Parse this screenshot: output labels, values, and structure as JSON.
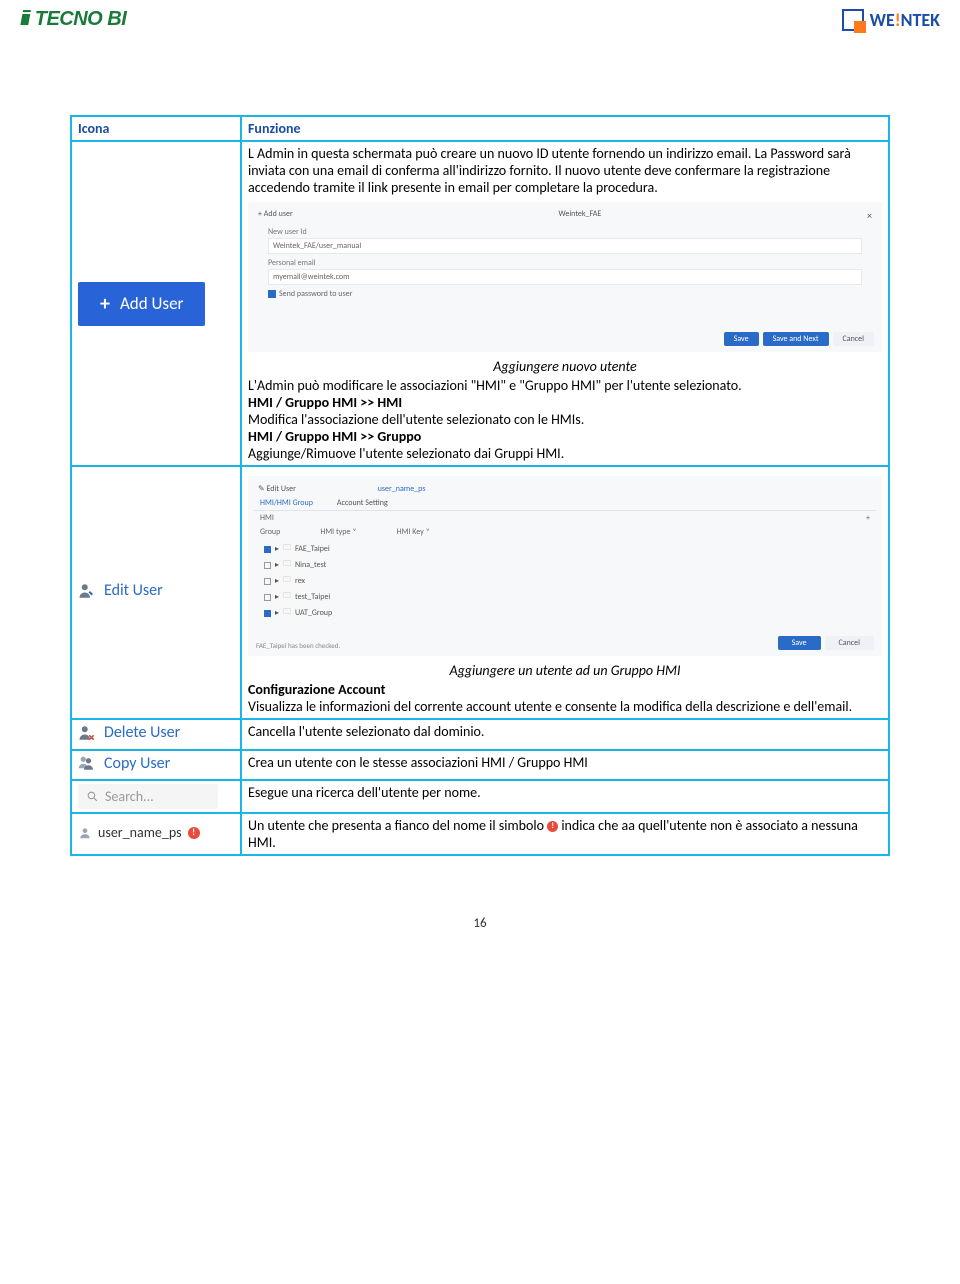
{
  "header": {
    "logo_left": "TECNO BI",
    "logo_right_pre": "WE",
    "logo_right_exc": "!",
    "logo_right_post": "NTEK"
  },
  "table": {
    "hdr_icona": "Icona",
    "hdr_funzione": "Funzione",
    "row1": {
      "icon_label": "Add User",
      "desc_p1": "L Admin in questa schermata può creare un nuovo ID utente fornendo un indirizzo email. La Password sarà inviata con una email di conferma all'indirizzo fornito. Il nuovo utente deve confermare la registrazione accedendo tramite il link presente in email per completare la procedura.",
      "mui": {
        "title_left": "+  Add user",
        "title_mid": "Weintek_FAE",
        "lbl_newuser": "New user Id",
        "val_newuser": "Weintek_FAE/user_manual",
        "lbl_email": "Personal email",
        "val_email": "myemail@weintek.com",
        "chk_send": "Send password to user",
        "btn_save": "Save",
        "btn_savenext": "Save and Next",
        "btn_cancel": "Cancel"
      },
      "caption1": "Aggiungere nuovo utente",
      "desc_p2_line1": "L'Admin può modificare le associazioni \"HMI\" e \"Gruppo HMI\" per l'utente selezionato.",
      "desc_p2_h1": "HMI / Gruppo HMI  >> HMI",
      "desc_p2_line2": "Modifica l'associazione dell'utente selezionato con le HMIs.",
      "desc_p2_h2": "HMI / Gruppo HMI  >> Gruppo",
      "desc_p2_line3": "Aggiunge/Rimuove l'utente selezionato dai Gruppi HMI."
    },
    "row2": {
      "icon_label": "Edit User",
      "mui2": {
        "title": "Edit User",
        "uname": "user_name_ps",
        "tab1": "HMI/HMI Group",
        "tab2": "Account Setting",
        "hmi_label": "HMI",
        "plus": "+",
        "col_group": "Group",
        "col_type": "HMI type  ˅",
        "col_key": "HMI Key  ˅",
        "items": [
          {
            "checked": true,
            "name": "FAE_Taipei"
          },
          {
            "checked": false,
            "name": "Nina_test"
          },
          {
            "checked": false,
            "name": "rex"
          },
          {
            "checked": false,
            "name": "test_Taipei"
          },
          {
            "checked": true,
            "name": "UAT_Group"
          }
        ],
        "status": "FAE_Taipei has been checked.",
        "btn_save": "Save",
        "btn_cancel": "Cancel"
      },
      "caption2": "Aggiungere un utente ad un Gruppo HMI",
      "desc_h": "Configurazione Account",
      "desc_p": "Visualizza le informazioni del corrente account utente e consente la modifica della descrizione e dell'email."
    },
    "row3": {
      "icon_label": "Delete User",
      "desc": "Cancella l'utente selezionato dal dominio."
    },
    "row4": {
      "icon_label": "Copy User",
      "desc": "Crea un utente con le stesse associazioni HMI / Gruppo HMI"
    },
    "row5": {
      "icon_placeholder": "Search...",
      "desc": "Esegue una ricerca dell'utente per nome."
    },
    "row6": {
      "icon_user": "user_name_ps",
      "desc_pre": "Un utente che presenta a fianco del nome il simbolo ",
      "desc_post": " indica che aa quell'utente non è associato a nessuna HMI."
    }
  },
  "page_num": "16"
}
